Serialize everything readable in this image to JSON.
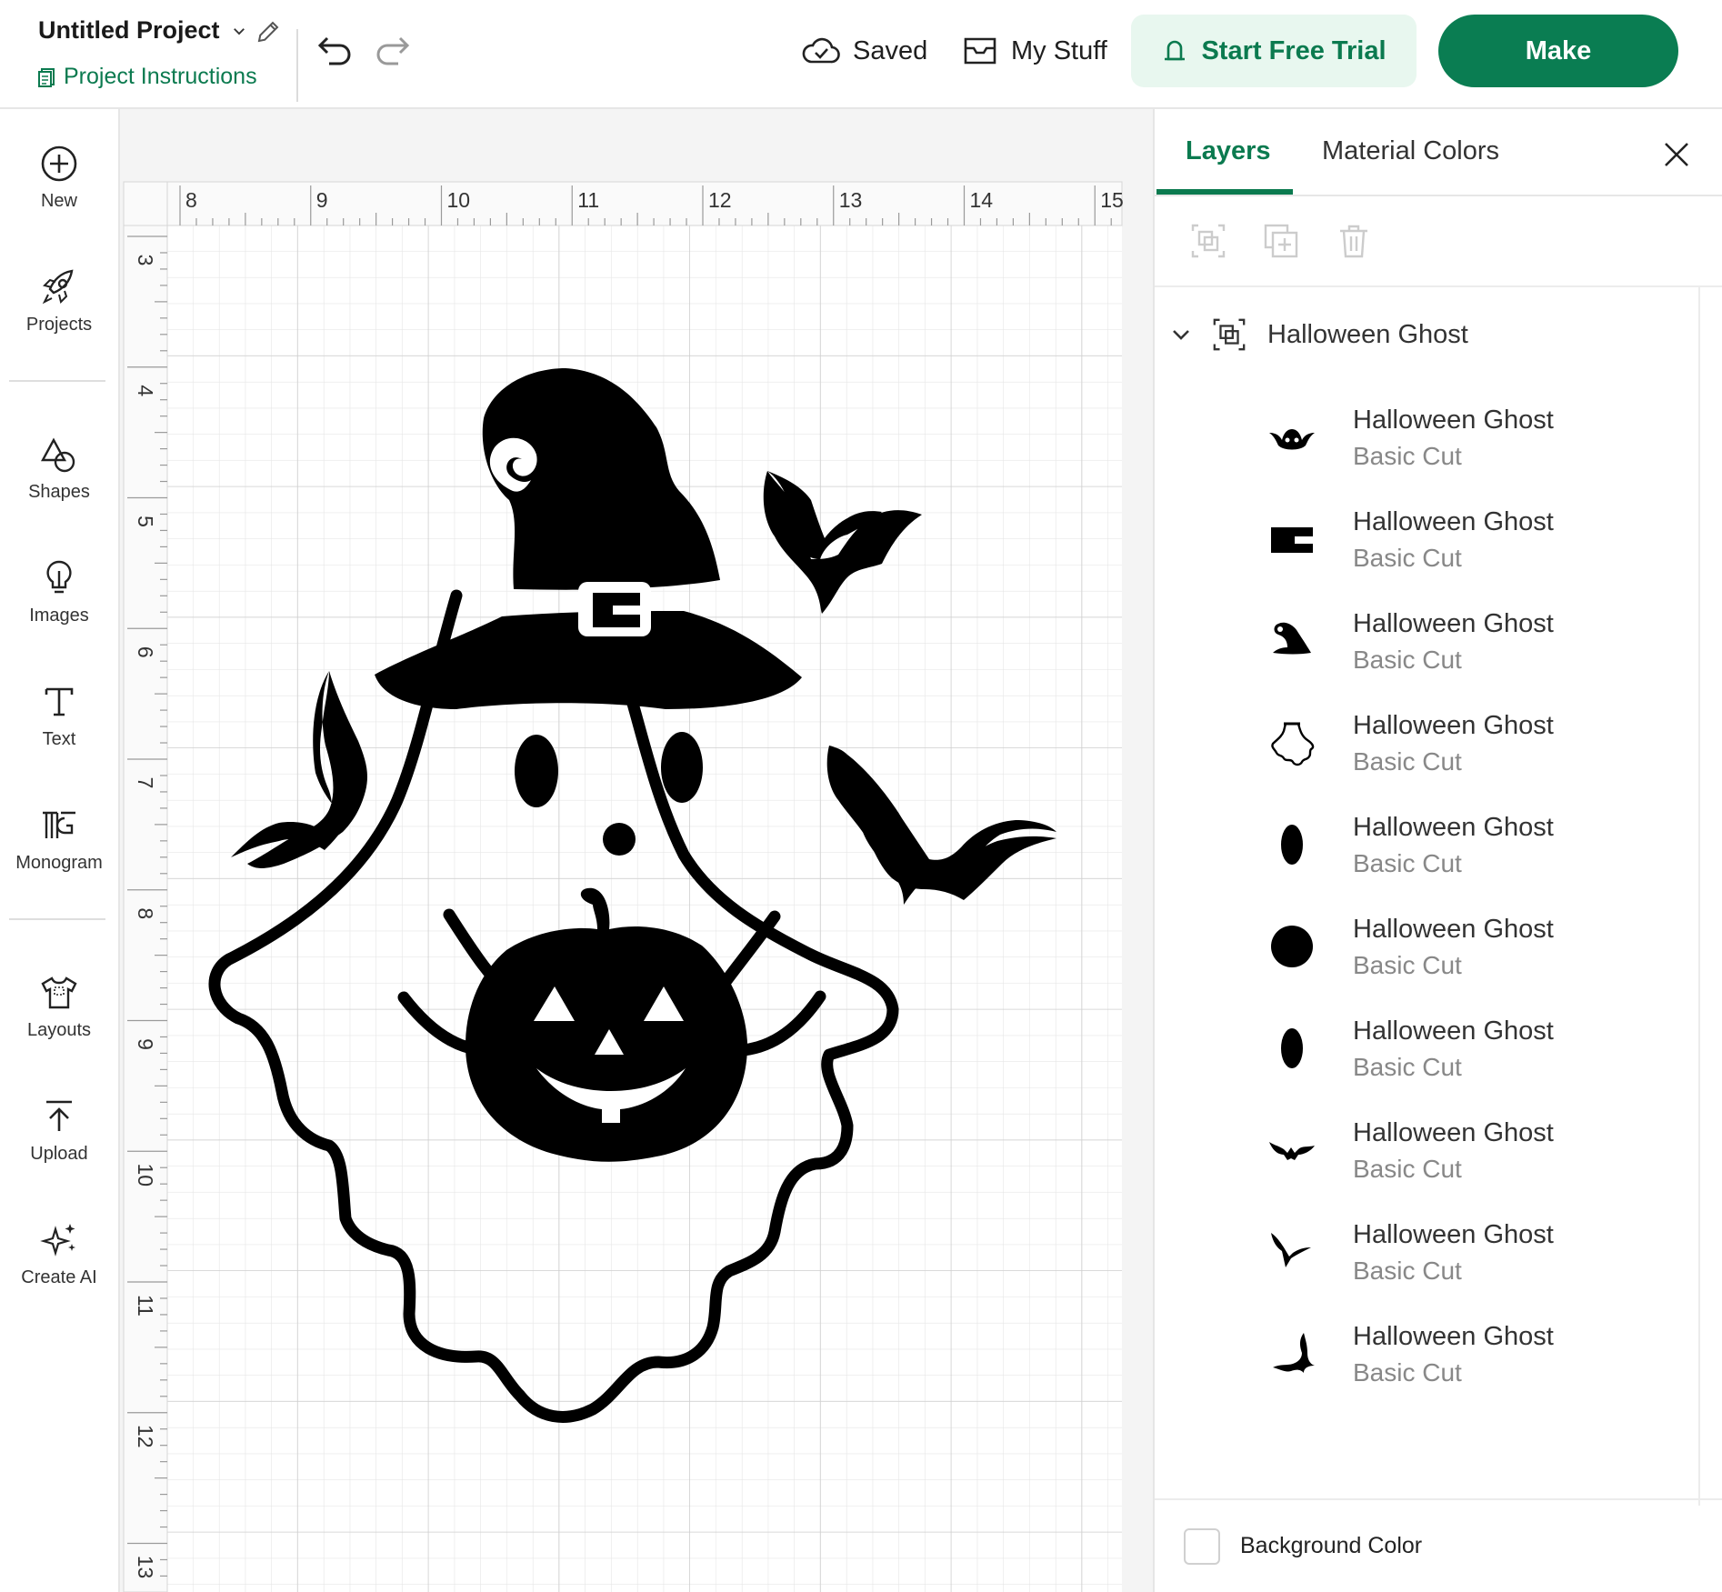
{
  "header": {
    "project_title": "Untitled Project",
    "project_instructions": "Project Instructions",
    "saved_label": "Saved",
    "my_stuff_label": "My Stuff",
    "trial_label": "Start Free Trial",
    "make_label": "Make"
  },
  "sidebar": {
    "items": [
      {
        "label": "New",
        "icon": "plus-circle-icon"
      },
      {
        "label": "Projects",
        "icon": "rocket-icon"
      },
      {
        "label": "Shapes",
        "icon": "shapes-icon"
      },
      {
        "label": "Images",
        "icon": "lightbulb-icon"
      },
      {
        "label": "Text",
        "icon": "text-icon"
      },
      {
        "label": "Monogram",
        "icon": "monogram-icon"
      },
      {
        "label": "Layouts",
        "icon": "tshirt-icon"
      },
      {
        "label": "Upload",
        "icon": "upload-icon"
      },
      {
        "label": "Create AI",
        "icon": "sparkle-icon"
      }
    ]
  },
  "canvas": {
    "ruler_top": [
      "8",
      "9",
      "10",
      "11",
      "12",
      "13",
      "14",
      "15"
    ],
    "ruler_left": [
      "3",
      "4",
      "5",
      "6",
      "7",
      "8",
      "9",
      "10",
      "11",
      "12",
      "13"
    ]
  },
  "panel": {
    "tabs": {
      "layers": "Layers",
      "material_colors": "Material Colors"
    },
    "group_name": "Halloween Ghost",
    "layers": [
      {
        "name": "Halloween Ghost",
        "op": "Basic Cut",
        "thumb": "bat-face-icon"
      },
      {
        "name": "Halloween Ghost",
        "op": "Basic Cut",
        "thumb": "buckle-icon"
      },
      {
        "name": "Halloween Ghost",
        "op": "Basic Cut",
        "thumb": "witch-hat-icon"
      },
      {
        "name": "Halloween Ghost",
        "op": "Basic Cut",
        "thumb": "ghost-outline-icon"
      },
      {
        "name": "Halloween Ghost",
        "op": "Basic Cut",
        "thumb": "eye-oval-icon"
      },
      {
        "name": "Halloween Ghost",
        "op": "Basic Cut",
        "thumb": "nose-dot-icon"
      },
      {
        "name": "Halloween Ghost",
        "op": "Basic Cut",
        "thumb": "eye-oval-icon"
      },
      {
        "name": "Halloween Ghost",
        "op": "Basic Cut",
        "thumb": "bat-icon"
      },
      {
        "name": "Halloween Ghost",
        "op": "Basic Cut",
        "thumb": "bat-icon"
      },
      {
        "name": "Halloween Ghost",
        "op": "Basic Cut",
        "thumb": "bat-icon"
      }
    ],
    "background_color_label": "Background Color"
  },
  "colors": {
    "accent": "#0b7a4f",
    "make_bg": "#0a7d52",
    "trial_bg": "#e8f7ef"
  }
}
